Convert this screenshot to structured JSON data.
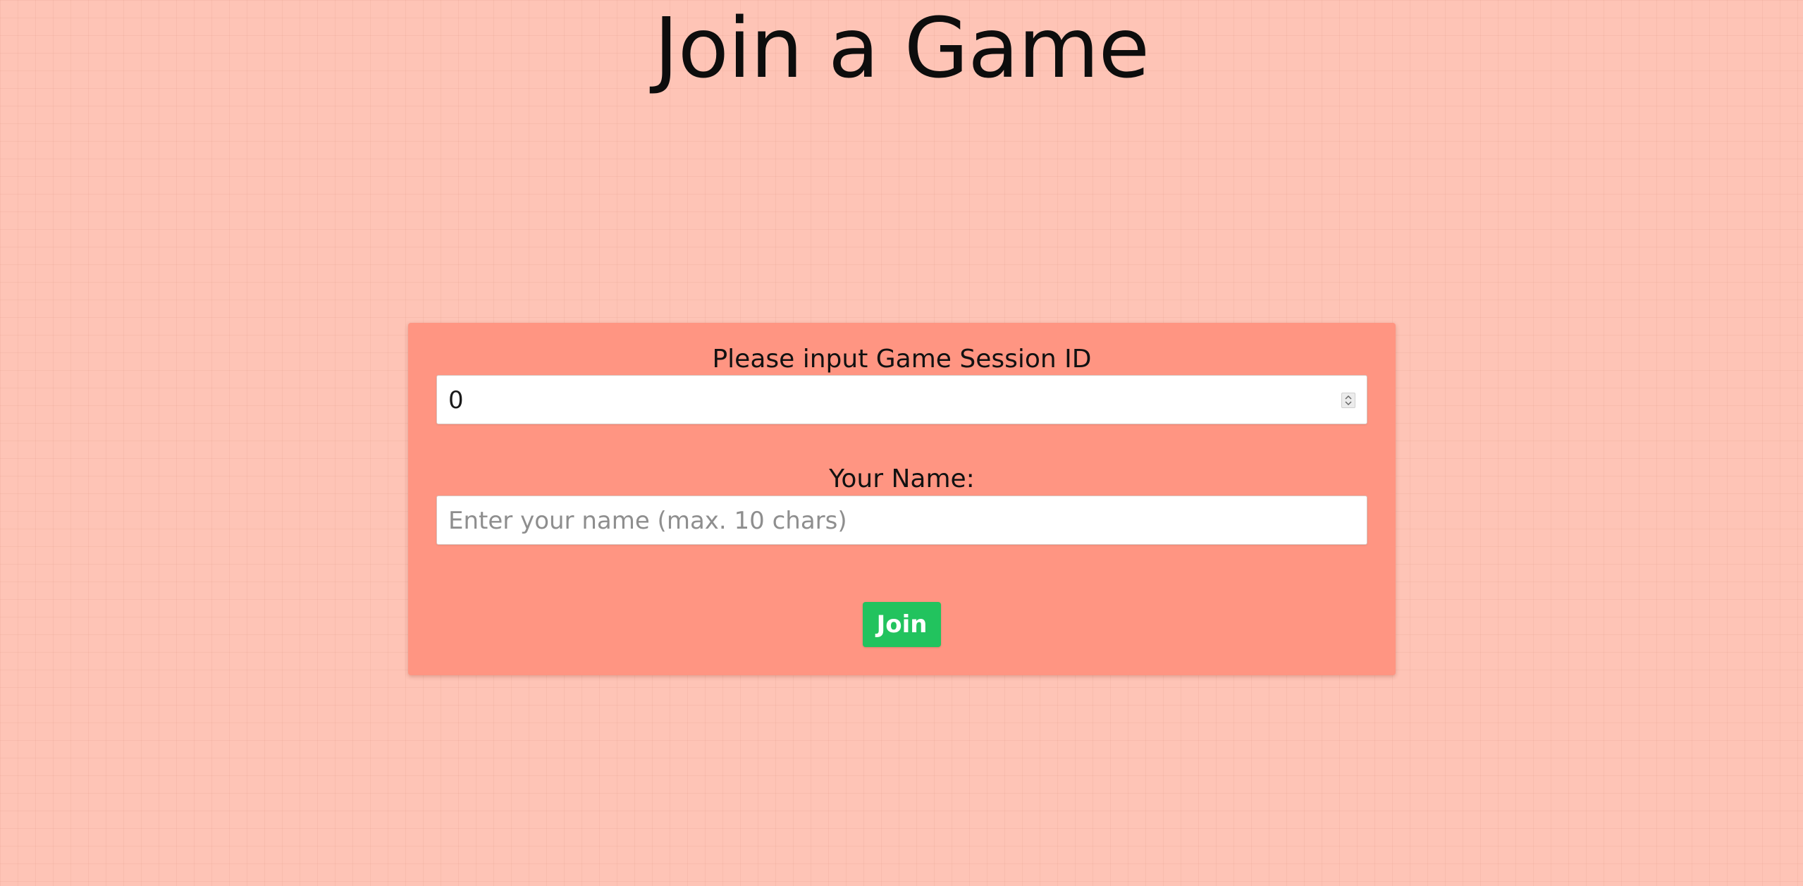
{
  "page": {
    "title": "Join a Game"
  },
  "form": {
    "session_label": "Please input Game Session ID",
    "session_value": "0",
    "name_label": "Your Name:",
    "name_placeholder": "Enter your name (max. 10 chars)",
    "join_label": "Join"
  },
  "icons": {
    "session_spinner": "number-spinner-icon"
  },
  "colors": {
    "background": "#fec4b6",
    "card": "#ff9582",
    "join_button": "#22c35e"
  }
}
